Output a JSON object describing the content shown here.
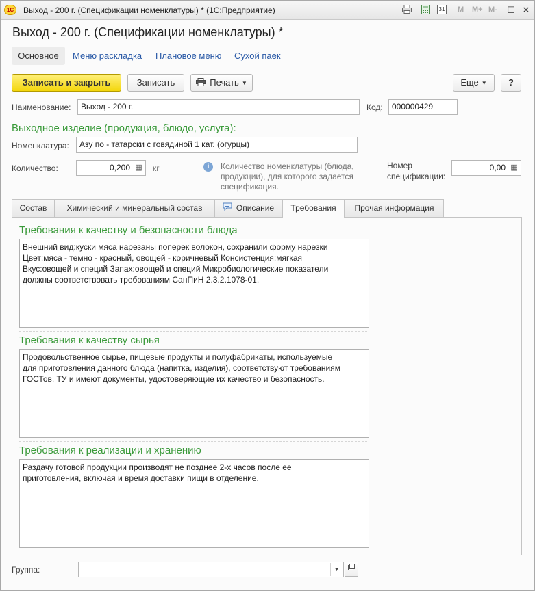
{
  "window": {
    "title": "Выход - 200 г. (Спецификации номенклатуры) * (1С:Предприятие)",
    "logo": "1С",
    "toolbar_icons": [
      "print-preview-icon",
      "calculator-icon",
      "calendar-icon"
    ],
    "memory_buttons": [
      "M",
      "M+",
      "M-"
    ],
    "calendar_day": "31",
    "restore_glyph": "☐",
    "close_glyph": "✕"
  },
  "form": {
    "title": "Выход - 200 г. (Спецификации номенклатуры) *"
  },
  "nav": {
    "main": "Основное",
    "links": [
      "Меню раскладка",
      "Плановое меню",
      "Сухой паек"
    ]
  },
  "toolbar": {
    "save_close": "Записать и закрыть",
    "save": "Записать",
    "print": "Печать",
    "more": "Еще",
    "help": "?"
  },
  "fields": {
    "name_label": "Наименование:",
    "name_value": "Выход - 200 г.",
    "code_label": "Код:",
    "code_value": "000000429",
    "output_section": "Выходное изделие (продукция, блюдо, услуга):",
    "nomenclature_label": "Номенклатура:",
    "nomenclature_value": "Азу по - татарски с говядиной 1 кат. (огурцы)",
    "quantity_label": "Количество:",
    "quantity_value": "0,200",
    "unit": "кг",
    "hint": "Количество номенклатуры (блюда, продукции), для которого задается спецификация.",
    "spec_number_label_1": "Номер",
    "spec_number_label_2": "спецификации:",
    "spec_number_value": "0,00"
  },
  "tabs": [
    "Состав",
    "Химический и минеральный состав",
    "Описание",
    "Требования",
    "Прочая информация"
  ],
  "requirements": {
    "quality_title": "Требования к качеству и безопасности блюда",
    "quality_lines": [
      "Внешний вид:куски мяса нарезаны поперек волокон, сохранили форму нарезки",
      "Цвет:мяса - темно - красный, овощей - коричневый Консистенция:мягкая",
      "Вкус:овощей и специй Запах:овощей и специй Микробиологические показатели",
      "должны соответствовать требованиям СанПиН 2.3.2.1078-01."
    ],
    "raw_title": "Требования к качеству сырья",
    "raw_lines": [
      "Продовольственное сырье, пищевые продукты и полуфабрикаты, используемые",
      "для приготовления данного блюда (напитка, изделия), соответствуют требованиям",
      "ГОСТов, ТУ и имеют документы, удостоверяющие их качество и безопасность."
    ],
    "storage_title": "Требования к реализации и хранению",
    "storage_lines": [
      "Раздачу готовой продукции производят не позднее 2-х часов после ее",
      "приготовления, включая и время доставки пищи в отделение."
    ]
  },
  "group": {
    "label": "Группа:",
    "value": ""
  }
}
